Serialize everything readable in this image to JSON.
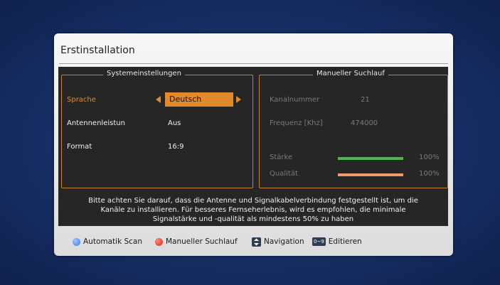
{
  "dialog": {
    "title": "Erstinstallation"
  },
  "system_settings": {
    "legend": "Systemeinstellungen",
    "rows": [
      {
        "label": "Sprache",
        "value": "Deutsch"
      },
      {
        "label": "Antennenleistun",
        "value": "Aus"
      },
      {
        "label": "Format",
        "value": "16:9"
      }
    ]
  },
  "manual_search": {
    "legend": "Manueller Suchlauf",
    "channel_label": "Kanalnummer",
    "channel_value": "21",
    "frequency_label": "Frequenz [Khz]",
    "frequency_value": "474000",
    "strength_label": "Stärke",
    "strength_value": "100%",
    "strength_level": 1.0,
    "quality_label": "Qualität",
    "quality_value": "100%",
    "quality_level": 1.0
  },
  "info_text": {
    "line1": "Bitte achten Sie darauf, dass die Antenne und Signalkabelverbindung festgestellt ist, um die",
    "line2": "Kanäle zu installieren. Für besseres Fernseherlebnis, wird es empfohlen, die minimale",
    "line3": "Signalstärke und -qualität als mindestens 50% zu haben"
  },
  "footer": {
    "auto_scan": "Automatik Scan",
    "manual_search": "Manueller Suchlauf",
    "navigation": "Navigation",
    "number_key": "0~9",
    "edit": "Editieren"
  },
  "colors": {
    "accent": "#e08a2c",
    "strength_bar": "#4cb84a",
    "quality_bar": "#ef9a6a",
    "blue_button": "#3a7ad8",
    "red_button": "#d3261c"
  },
  "icons": [
    "blue-button-icon",
    "red-button-icon",
    "navigation-arrows-icon",
    "number-keys-icon",
    "arrow-left-icon",
    "arrow-right-icon"
  ]
}
